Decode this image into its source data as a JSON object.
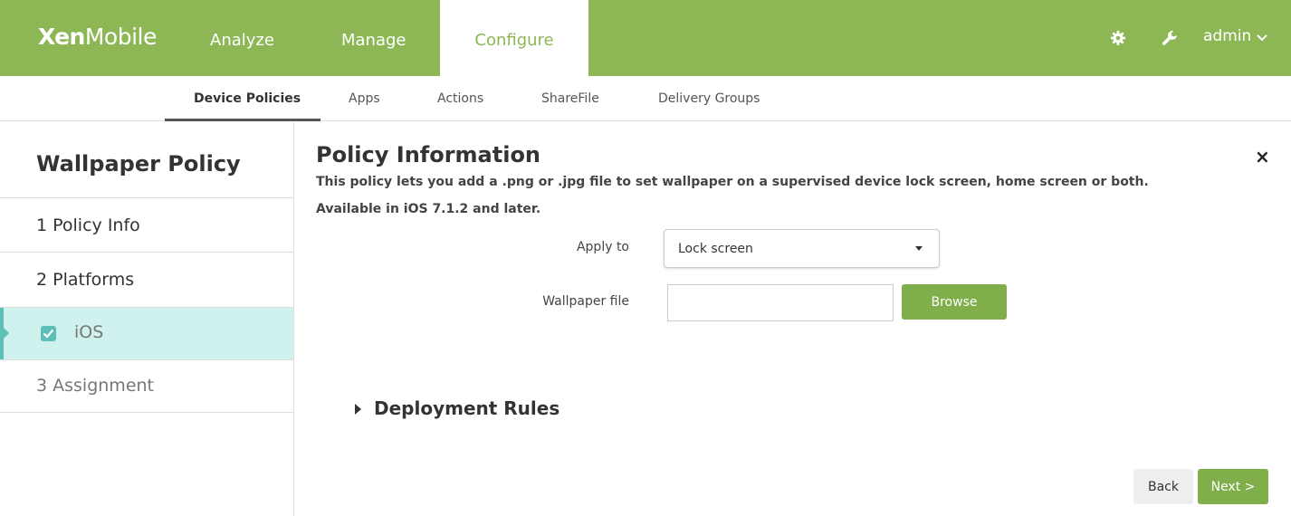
{
  "app": {
    "logo_bold": "Xen",
    "logo_light": "Mobile",
    "user": "admin"
  },
  "top_nav": {
    "tabs": [
      {
        "label": "Analyze"
      },
      {
        "label": "Manage"
      },
      {
        "label": "Configure"
      }
    ],
    "active_tab": "Configure",
    "icons": [
      "gear-icon",
      "wrench-icon",
      "chevron-down-icon"
    ]
  },
  "sub_nav": {
    "tabs": [
      {
        "label": "Device Policies"
      },
      {
        "label": "Apps"
      },
      {
        "label": "Actions"
      },
      {
        "label": "ShareFile"
      },
      {
        "label": "Delivery Groups"
      }
    ],
    "active_tab": "Device Policies"
  },
  "sidebar": {
    "title": "Wallpaper Policy",
    "items": [
      {
        "label": "1  Policy Info"
      },
      {
        "label": "2  Platforms"
      },
      {
        "label": "iOS",
        "checked": true
      },
      {
        "label": "3  Assignment"
      }
    ]
  },
  "main": {
    "title": "Policy Information",
    "description_line1": "This policy lets you add a .png or .jpg file to set wallpaper on a supervised device lock screen, home screen or both.",
    "description_line2": "Available in iOS 7.1.2 and later.",
    "apply_to_label": "Apply to",
    "apply_to_value": "Lock screen",
    "wallpaper_label": "Wallpaper file",
    "wallpaper_value": "",
    "browse_label": "Browse",
    "deployment_rules": "Deployment Rules",
    "close_symbol": "×",
    "back_label": "Back",
    "next_label": "Next >"
  },
  "colors": {
    "accent_green": "#8db755",
    "button_green": "#7fae4a",
    "selection_bg": "#cff2ef",
    "selection_marker": "#5bc0b8"
  }
}
